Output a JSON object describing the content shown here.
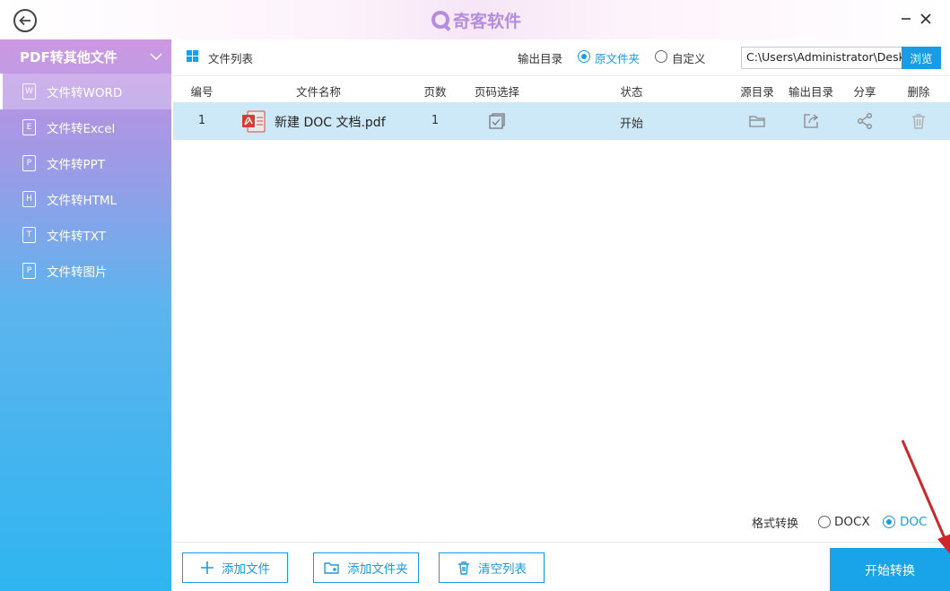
{
  "app": {
    "logo_text": "奇客软件"
  },
  "sidebar": {
    "header": "PDF转其他文件",
    "items": [
      {
        "label": "文件转WORD",
        "icon_letter": "W"
      },
      {
        "label": "文件转Excel",
        "icon_letter": "E"
      },
      {
        "label": "文件转PPT",
        "icon_letter": "P"
      },
      {
        "label": "文件转HTML",
        "icon_letter": "H"
      },
      {
        "label": "文件转TXT",
        "icon_letter": "T"
      },
      {
        "label": "文件转图片",
        "icon_letter": "P"
      }
    ]
  },
  "toolbar": {
    "title": "文件列表",
    "output_label": "输出目录",
    "option_source": "原文件夹",
    "option_custom": "自定义",
    "path_value": "C:\\Users\\Administrator\\Desk",
    "browse": "浏览"
  },
  "table": {
    "headers": [
      "编号",
      "文件名称",
      "页数",
      "页码选择",
      "状态",
      "源目录",
      "输出目录",
      "分享",
      "删除"
    ],
    "rows": [
      {
        "index": "1",
        "name": "新建 DOC 文档.pdf",
        "pages": "1",
        "status": "开始"
      }
    ]
  },
  "format": {
    "label": "格式转换",
    "options": [
      "DOCX",
      "DOC"
    ],
    "selected": "DOC"
  },
  "footer": {
    "add_file": "添加文件",
    "add_folder": "添加文件夹",
    "clear_list": "清空列表",
    "start": "开始转换"
  },
  "colors": {
    "accent": "#1a9be6",
    "row_highlight": "#cde9f7",
    "annotation_arrow": "#d0262b"
  }
}
